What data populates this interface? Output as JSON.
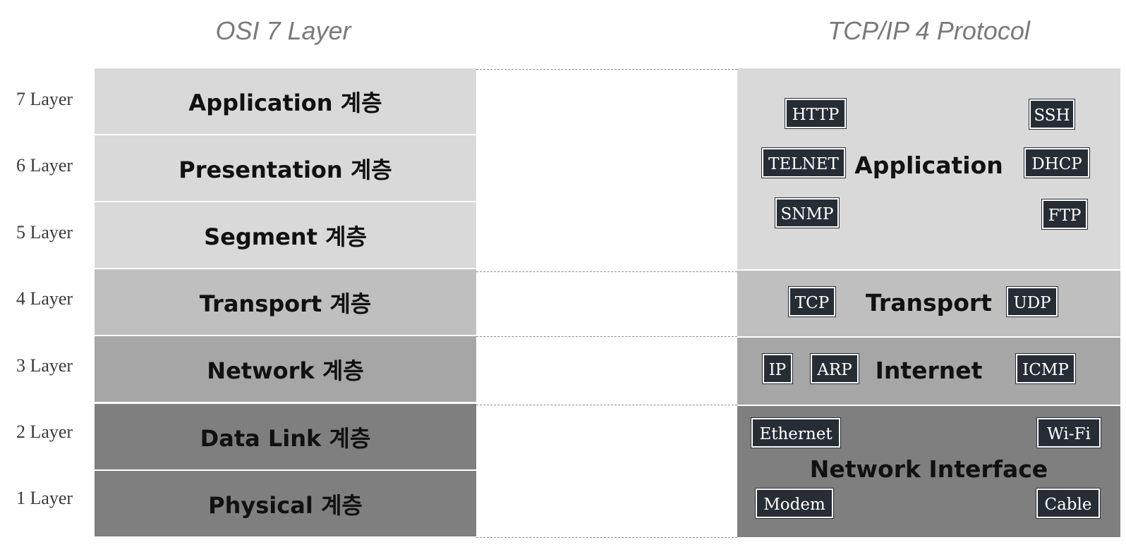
{
  "titles": {
    "osi": "OSI 7 Layer",
    "tcp": "TCP/IP 4 Protocol"
  },
  "layer_labels": [
    "7 Layer",
    "6 Layer",
    "5 Layer",
    "4 Layer",
    "3 Layer",
    "2 Layer",
    "1 Layer"
  ],
  "osi_layers": [
    "Application 계층",
    "Presentation 계층",
    "Segment 계층",
    "Transport 계층",
    "Network 계층",
    "Data Link 계층",
    "Physical 계층"
  ],
  "tcp_layers": {
    "application": {
      "name": "Application",
      "protocols": [
        "HTTP",
        "SSH",
        "TELNET",
        "DHCP",
        "SNMP",
        "FTP"
      ]
    },
    "transport": {
      "name": "Transport",
      "protocols": [
        "TCP",
        "UDP"
      ]
    },
    "internet": {
      "name": "Internet",
      "protocols": [
        "IP",
        "ARP",
        "ICMP"
      ]
    },
    "network_interface": {
      "name": "Network Interface",
      "protocols": [
        "Ethernet",
        "Wi-Fi",
        "Modem",
        "Cable"
      ]
    }
  },
  "colors": {
    "light_gray": "#d9d9d9",
    "mid_gray": "#bfbfbf",
    "gray": "#a6a6a6",
    "dark_gray": "#7f7f7f",
    "protocol_box": "#262d35"
  }
}
